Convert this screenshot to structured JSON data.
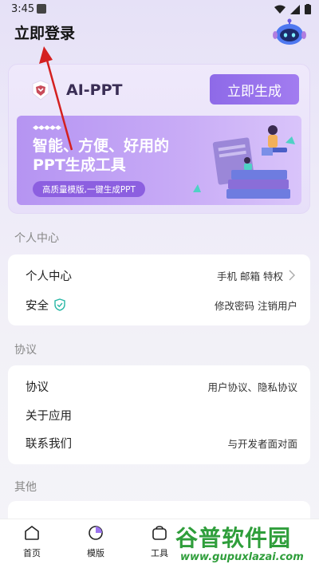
{
  "status_bar": {
    "time": "3:45"
  },
  "header": {
    "title": "立即登录"
  },
  "ppt_card": {
    "app_name": "AI-PPT",
    "generate_button": "立即生成",
    "banner": {
      "title": "智能、方便、好用的PPT生成工具",
      "tagline": "高质量模版,一键生成PPT"
    }
  },
  "sections": {
    "personal": {
      "label": "个人中心",
      "rows": [
        {
          "label": "个人中心",
          "value": "手机 邮箱 特权"
        },
        {
          "label": "安全",
          "value": "修改密码  注销用户"
        }
      ]
    },
    "agreement": {
      "label": "协议",
      "rows": [
        {
          "label": "协议",
          "value": "用户协议、隐私协议"
        },
        {
          "label": "关于应用",
          "value": ""
        },
        {
          "label": "联系我们",
          "value": "与开发者面对面"
        }
      ]
    },
    "other": {
      "label": "其他"
    }
  },
  "bottom_nav": {
    "items": [
      {
        "label": "首页",
        "icon": "home-icon"
      },
      {
        "label": "模版",
        "icon": "template-icon"
      },
      {
        "label": "工具",
        "icon": "tools-icon"
      }
    ]
  },
  "watermark": {
    "text": "谷普软件园",
    "url": "www.gupuxlazai.com"
  },
  "colors": {
    "accent": "#9b74ee",
    "background": "#ece8f8",
    "shield": "#27b7a5",
    "watermark": "#2f9e3b"
  }
}
